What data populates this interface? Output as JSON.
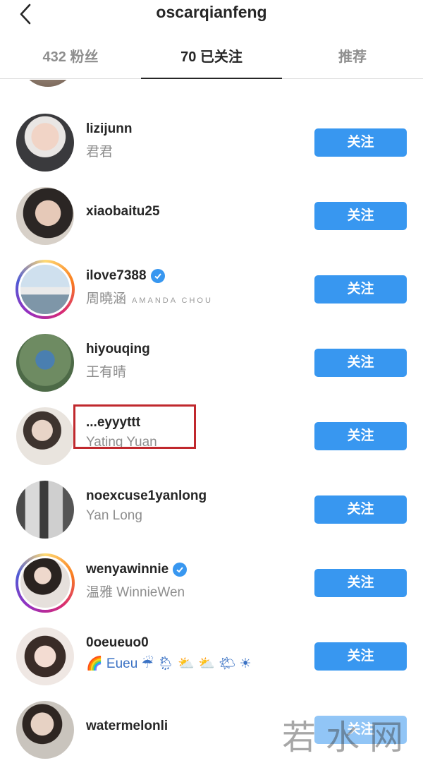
{
  "header": {
    "title": "oscarqianfeng",
    "back_icon": "chevron-left-icon"
  },
  "tabs": [
    {
      "label": "432 粉丝",
      "active": false
    },
    {
      "label": "70 已关注",
      "active": true
    },
    {
      "label": "推荐",
      "active": false
    }
  ],
  "follow_label": "关注",
  "users": [
    {
      "username": "lizijunn",
      "fullname": "君君",
      "verified": false,
      "story": false
    },
    {
      "username": "xiaobaitu25",
      "fullname": "",
      "verified": false,
      "story": false
    },
    {
      "username": "ilove7388",
      "fullname": "周曉涵",
      "fullname_extra": "AMANDA CHOU",
      "verified": true,
      "story": true
    },
    {
      "username": "hiyouqing",
      "fullname": "王有晴",
      "verified": false,
      "story": false
    },
    {
      "username": "...eyyyttt",
      "fullname": "Yating Yuan",
      "verified": false,
      "story": false,
      "highlighted": true
    },
    {
      "username": "noexcuse1yanlong",
      "fullname": "Yan Long",
      "verified": false,
      "story": false
    },
    {
      "username": "wenyawinnie",
      "fullname": "温雅 WinnieWen",
      "verified": true,
      "story": true
    },
    {
      "username": "0oeueuo0",
      "fullname": "🌈 Eueu ☔ 🌦 ⛅ ⛅ 🌤 ☀",
      "verified": false,
      "story": false
    },
    {
      "username": "watermelonli",
      "fullname": "",
      "verified": false,
      "story": false
    }
  ],
  "watermark": "若水网",
  "colors": {
    "follow_button": "#3897f0",
    "primary_text": "#262626",
    "secondary_text": "#8e8e8e",
    "highlight_box": "#c0282d"
  }
}
